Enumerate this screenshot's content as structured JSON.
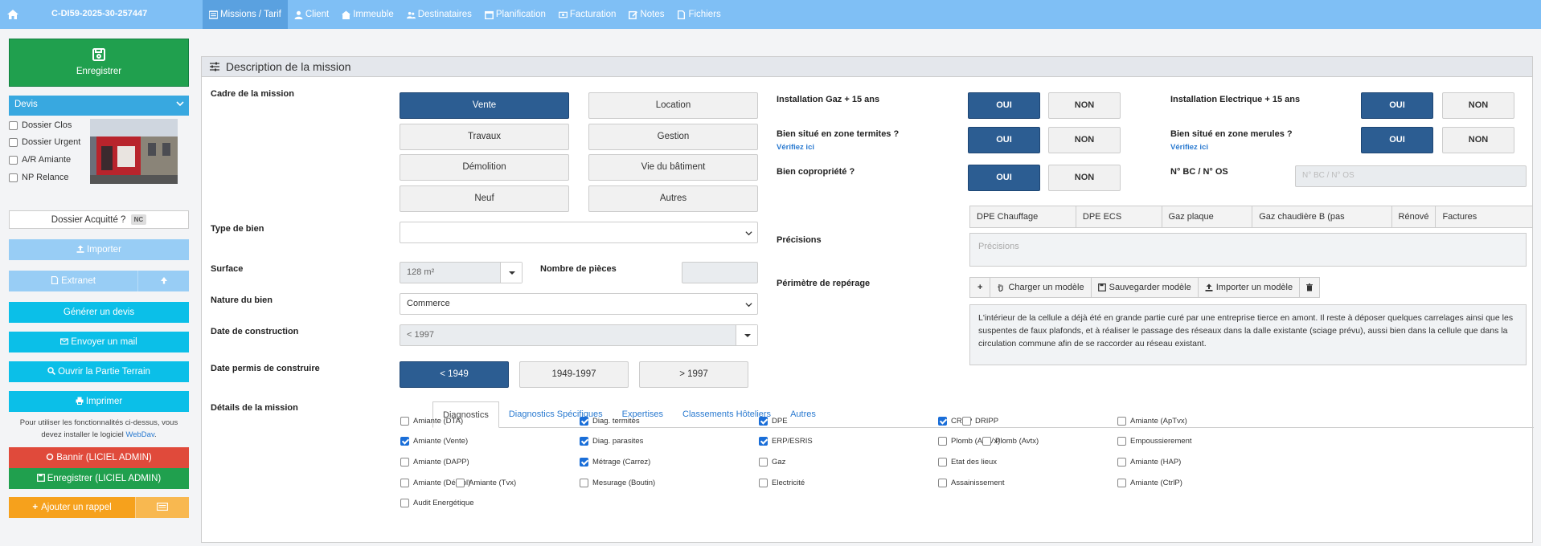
{
  "header": {
    "dossier_id": "C-DI59-2025-30-257447",
    "tabs": [
      {
        "label": "Missions / Tarif",
        "icon": "list-icon"
      },
      {
        "label": "Client",
        "icon": "user-icon"
      },
      {
        "label": "Immeuble",
        "icon": "building-icon"
      },
      {
        "label": "Destinataires",
        "icon": "users-icon"
      },
      {
        "label": "Planification",
        "icon": "calendar-icon"
      },
      {
        "label": "Facturation",
        "icon": "money-icon"
      },
      {
        "label": "Notes",
        "icon": "edit-icon"
      },
      {
        "label": "Fichiers",
        "icon": "file-icon"
      }
    ]
  },
  "sidebar": {
    "save_label": "Enregistrer",
    "status_value": "Devis",
    "checkboxes": [
      {
        "label": "Dossier Clos",
        "checked": false
      },
      {
        "label": "Dossier Urgent",
        "checked": false
      },
      {
        "label": "A/R Amiante",
        "checked": false
      },
      {
        "label": "NP Relance",
        "checked": false
      }
    ],
    "acquitte_label": "Dossier Acquitté ?",
    "acquitte_badge": "NC",
    "import_label": "Importer",
    "extranet_label": "Extranet",
    "generate_quote": "Générer un devis",
    "send_mail": "Envoyer un mail",
    "open_field": "Ouvrir la Partie Terrain",
    "print": "Imprimer",
    "note_text": "Pour utiliser les fonctionnalités ci-dessus, vous devez installer le logiciel",
    "note_link": "WebDav",
    "note_end": ".",
    "ban": "Bannir (LICIEL ADMIN)",
    "save_admin": "Enregistrer (LICIEL ADMIN)",
    "add_reminder": "Ajouter un rappel"
  },
  "panel": {
    "title": "Description de la mission",
    "cadre_label": "Cadre de la mission",
    "cadre_options": [
      {
        "label": "Vente",
        "selected": true
      },
      {
        "label": "Location",
        "selected": false
      },
      {
        "label": "Travaux",
        "selected": false
      },
      {
        "label": "Gestion",
        "selected": false
      },
      {
        "label": "Démolition",
        "selected": false
      },
      {
        "label": "Vie du bâtiment",
        "selected": false
      },
      {
        "label": "Neuf",
        "selected": false
      },
      {
        "label": "Autres",
        "selected": false
      }
    ],
    "type_bien_label": "Type de bien",
    "type_bien_value": "",
    "surface_label": "Surface",
    "surface_value": "128 m²",
    "pieces_label": "Nombre de pièces",
    "pieces_value": "",
    "nature_label": "Nature du bien",
    "nature_value": "Commerce",
    "date_constr_label": "Date de construction",
    "date_constr_value": "< 1997",
    "permis_label": "Date permis de construire",
    "permis_options": [
      {
        "label": "< 1949",
        "selected": true
      },
      {
        "label": "1949-1997",
        "selected": false
      },
      {
        "label": "> 1997",
        "selected": false
      }
    ],
    "details_label": "Détails de la mission",
    "gaz_label": "Installation Gaz + 15 ans",
    "elec_label": "Installation Electrique + 15 ans",
    "termites_label": "Bien situé en zone termites ?",
    "merules_label": "Bien situé en zone merules ?",
    "verif_link": "Vérifiez ici",
    "copro_label": "Bien copropriété ?",
    "bc_label": "N° BC / N° OS",
    "bc_placeholder": "N° BC / N° OS",
    "oui": "OUI",
    "non": "NON",
    "tags": [
      "DPE Chauffage collectif",
      "DPE ECS Collectif",
      "Gaz plaque cuisson",
      "Gaz chaudière B (pas ventouse)",
      "Rénové",
      "Factures nécessaires"
    ],
    "precisions_label": "Précisions",
    "precisions_placeholder": "Précisions",
    "perimetre_label": "Périmètre de repérage",
    "tools": [
      "Charger un modèle",
      "Sauvegarder modèle",
      "Importer un modèle"
    ],
    "perimetre_text": "L'intérieur de la cellule a déjà été en grande partie curé par une entreprise tierce en amont. Il reste à déposer quelques carrelages ainsi que les suspentes de faux plafonds, et à réaliser le passage des réseaux dans la dalle existante (sciage prévu), aussi bien dans la cellule que dans la circulation commune afin de se raccorder au réseau existant.",
    "detail_tabs": [
      {
        "label": "Diagnostics",
        "active": true
      },
      {
        "label": "Diagnostics Spécifiques",
        "active": false
      },
      {
        "label": "Expertises",
        "active": false
      },
      {
        "label": "Classements Hôteliers",
        "active": false
      },
      {
        "label": "Autres",
        "active": false
      }
    ],
    "diagnostics": [
      {
        "label": "Amiante (DTA)",
        "checked": false
      },
      {
        "label": "Diag. termites",
        "checked": true
      },
      {
        "label": "DPE",
        "checked": true
      },
      {
        "label": "CREP",
        "checked": true
      },
      {
        "label": "DRIPP",
        "checked": false
      },
      {
        "label": "Amiante (ApTvx)",
        "checked": false
      },
      {
        "label": "Amiante (Vente)",
        "checked": true
      },
      {
        "label": "Diag. parasites",
        "checked": true
      },
      {
        "label": "ERP/ESRIS",
        "checked": true
      },
      {
        "label": "Plomb (AptVx)",
        "checked": false
      },
      {
        "label": "Plomb (Avtx)",
        "checked": false
      },
      {
        "label": "Empoussierement",
        "checked": false
      },
      {
        "label": "Amiante (DAPP)",
        "checked": false
      },
      {
        "label": "Métrage (Carrez)",
        "checked": true
      },
      {
        "label": "Gaz",
        "checked": false
      },
      {
        "label": "Etat des lieux",
        "checked": false
      },
      {
        "label": "Amiante (HAP)",
        "checked": false
      },
      {
        "label": "Amiante (Démol)",
        "checked": false
      },
      {
        "label": "Amiante (Tvx)",
        "checked": false
      },
      {
        "label": "Mesurage (Boutin)",
        "checked": false
      },
      {
        "label": "Electricité",
        "checked": false
      },
      {
        "label": "Assainissement",
        "checked": false
      },
      {
        "label": "Amiante (CtrlP)",
        "checked": false
      },
      {
        "label": "Audit Energétique",
        "checked": false
      }
    ]
  }
}
